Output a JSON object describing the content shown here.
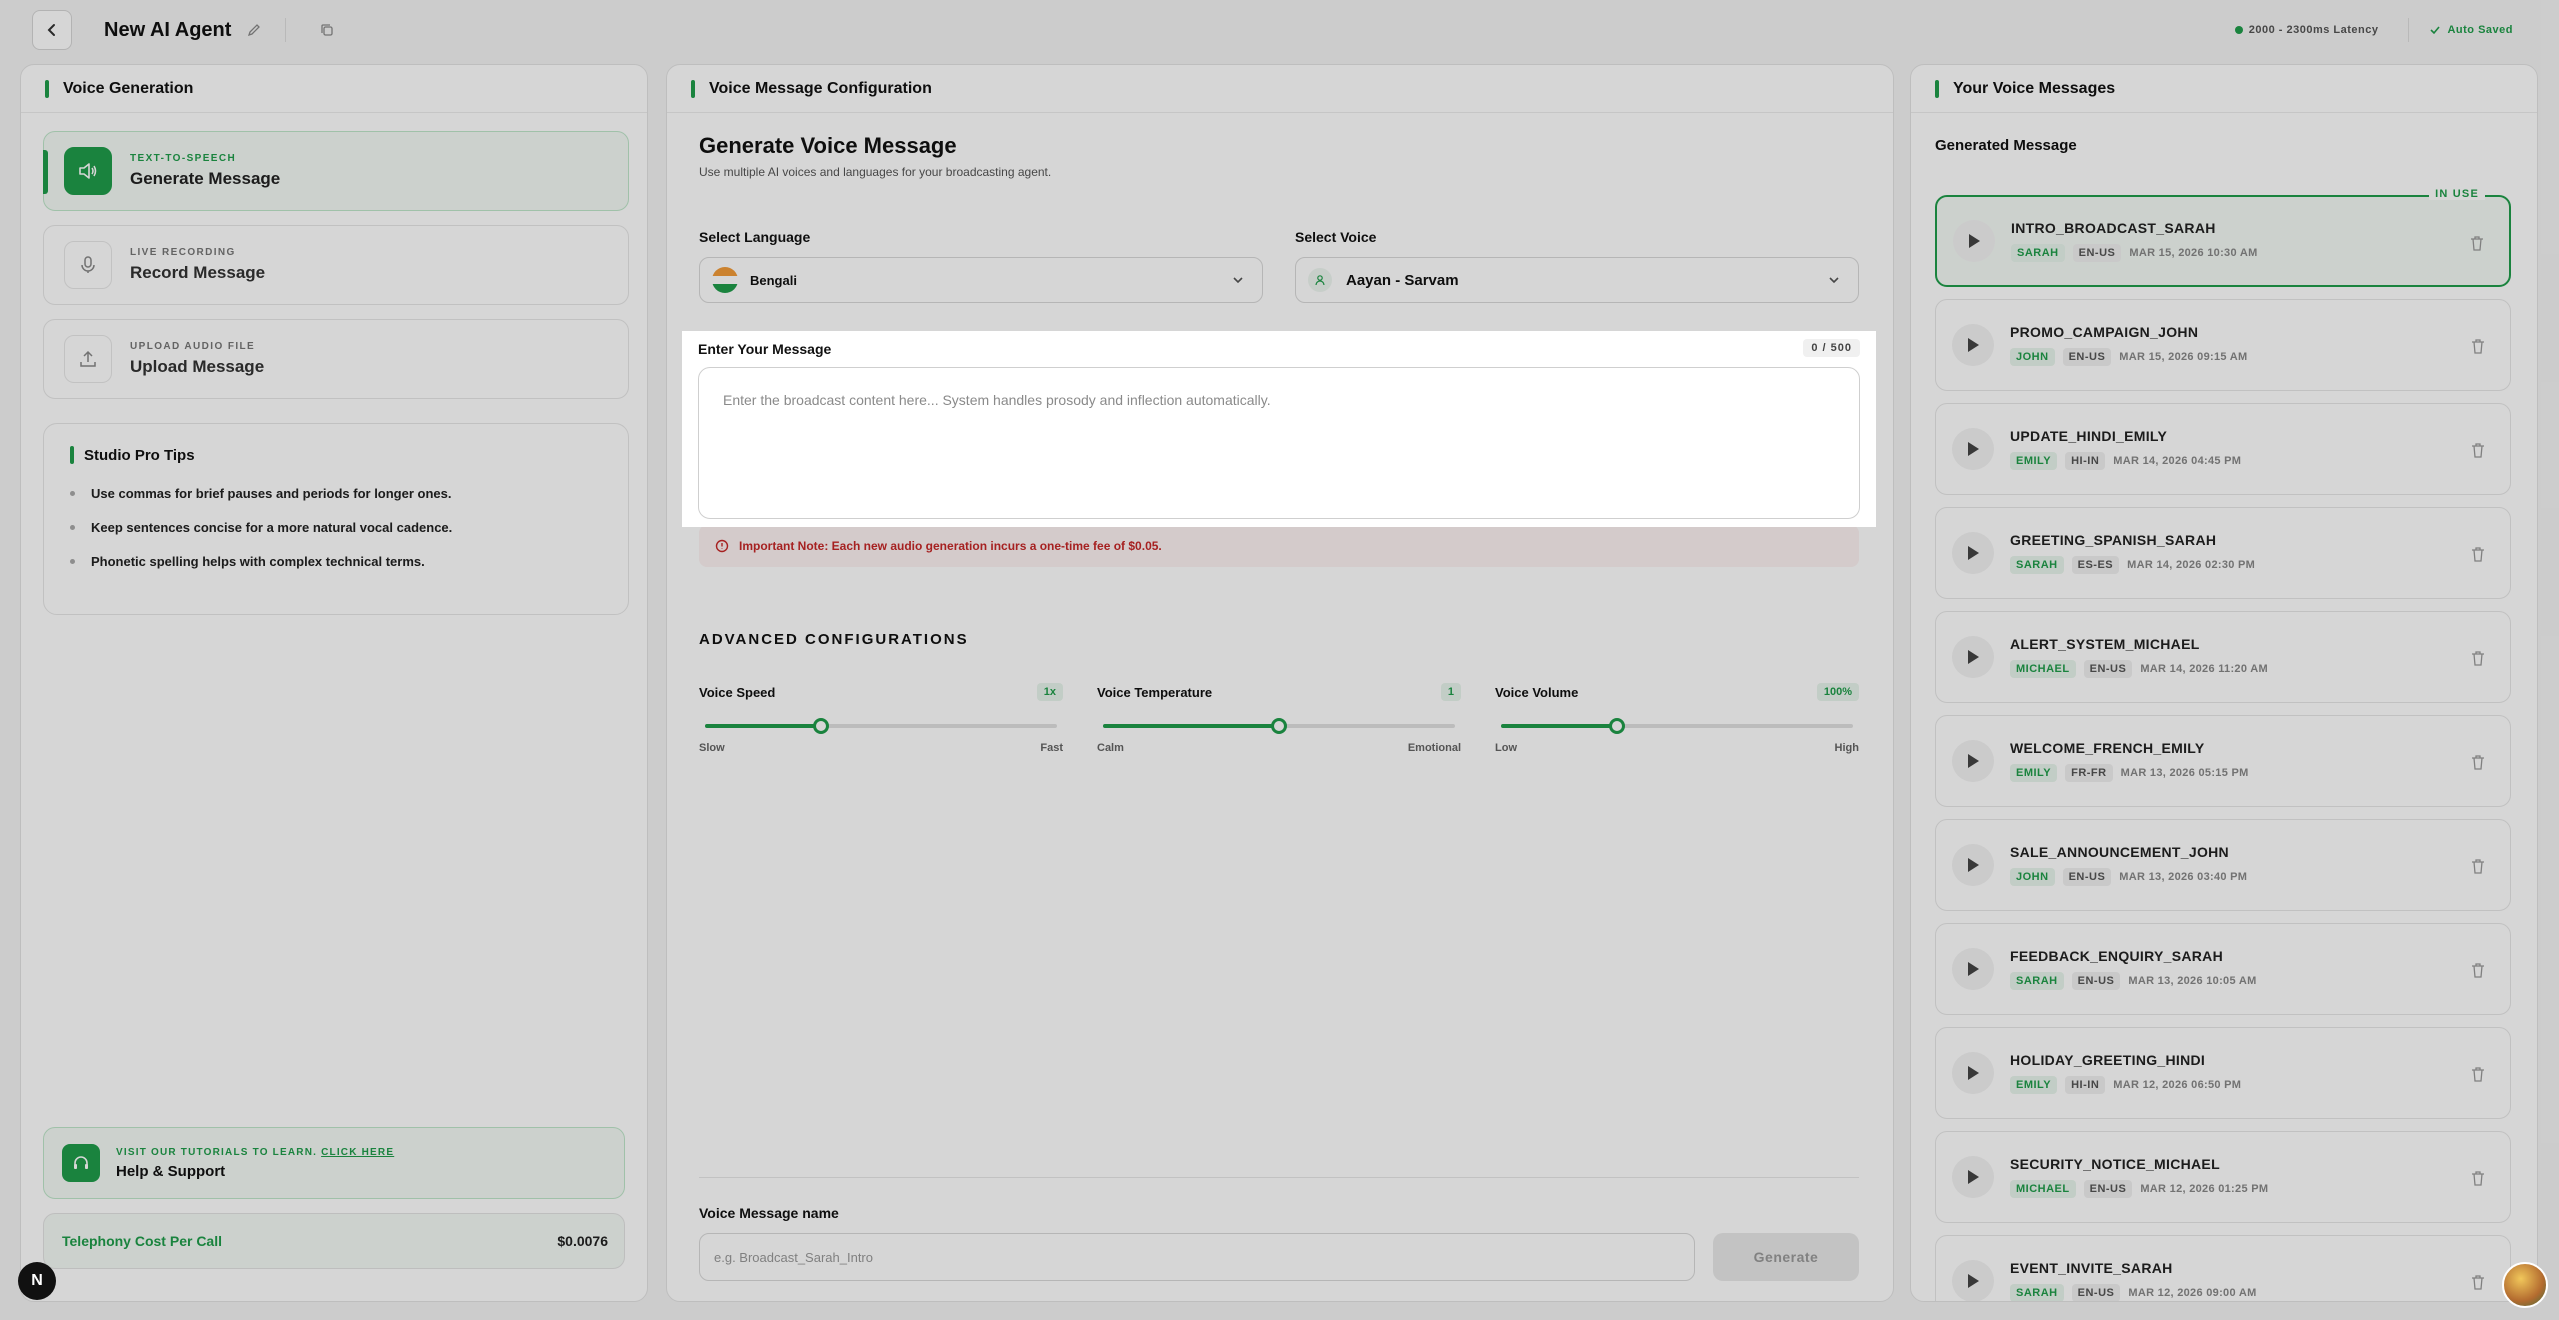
{
  "topbar": {
    "title": "New AI Agent",
    "latency": "2000 - 2300ms Latency",
    "saved": "Auto Saved"
  },
  "left": {
    "header": "Voice Generation",
    "modes": [
      {
        "sub": "TEXT-TO-SPEECH",
        "title": "Generate Message",
        "icon": "speaker-icon"
      },
      {
        "sub": "LIVE RECORDING",
        "title": "Record Message",
        "icon": "microphone-icon"
      },
      {
        "sub": "UPLOAD AUDIO FILE",
        "title": "Upload Message",
        "icon": "upload-icon"
      }
    ],
    "tips": {
      "title": "Studio Pro Tips",
      "items": [
        "Use commas for brief pauses and periods for longer ones.",
        "Keep sentences concise for a more natural vocal cadence.",
        "Phonetic spelling helps with complex technical terms."
      ]
    },
    "help": {
      "sub_prefix": "VISIT OUR TUTORIALS TO LEARN.",
      "sub_link": "CLICK HERE",
      "title": "Help & Support"
    },
    "cost": {
      "label": "Telephony Cost Per Call",
      "value": "$0.0076"
    }
  },
  "center": {
    "header": "Voice Message Configuration",
    "title": "Generate Voice Message",
    "subtitle": "Use multiple AI voices and languages for your broadcasting agent.",
    "language_label": "Select Language",
    "language_value": "Bengali",
    "voice_label": "Select Voice",
    "voice_value": "Aayan - Sarvam",
    "message_label": "Enter Your Message",
    "counter": "0 / 500",
    "message_placeholder": "Enter the broadcast content here... System handles prosody and inflection automatically.",
    "note": "Important Note: Each new audio generation incurs a one-time fee of $0.05.",
    "advanced_title": "ADVANCED CONFIGURATIONS",
    "sliders": [
      {
        "label": "Voice Speed",
        "value": "1x",
        "min_label": "Slow",
        "max_label": "Fast",
        "level": 0.33
      },
      {
        "label": "Voice Temperature",
        "value": "1",
        "min_label": "Calm",
        "max_label": "Emotional",
        "level": 0.5
      },
      {
        "label": "Voice Volume",
        "value": "100%",
        "min_label": "Low",
        "max_label": "High",
        "level": 0.33
      }
    ],
    "name_label": "Voice Message name",
    "name_placeholder": "e.g. Broadcast_Sarah_Intro",
    "generate_label": "Generate"
  },
  "right": {
    "header": "Your Voice Messages",
    "section_title": "Generated Message",
    "in_use_label": "IN USE",
    "messages": [
      {
        "name": "INTRO_BROADCAST_SARAH",
        "voice": "SARAH",
        "lang": "EN-US",
        "date": "MAR 15, 2026 10:30 AM",
        "in_use": true
      },
      {
        "name": "PROMO_CAMPAIGN_JOHN",
        "voice": "JOHN",
        "lang": "EN-US",
        "date": "MAR 15, 2026 09:15 AM"
      },
      {
        "name": "UPDATE_HINDI_EMILY",
        "voice": "EMILY",
        "lang": "HI-IN",
        "date": "MAR 14, 2026 04:45 PM"
      },
      {
        "name": "GREETING_SPANISH_SARAH",
        "voice": "SARAH",
        "lang": "ES-ES",
        "date": "MAR 14, 2026 02:30 PM"
      },
      {
        "name": "ALERT_SYSTEM_MICHAEL",
        "voice": "MICHAEL",
        "lang": "EN-US",
        "date": "MAR 14, 2026 11:20 AM"
      },
      {
        "name": "WELCOME_FRENCH_EMILY",
        "voice": "EMILY",
        "lang": "FR-FR",
        "date": "MAR 13, 2026 05:15 PM"
      },
      {
        "name": "SALE_ANNOUNCEMENT_JOHN",
        "voice": "JOHN",
        "lang": "EN-US",
        "date": "MAR 13, 2026 03:40 PM"
      },
      {
        "name": "FEEDBACK_ENQUIRY_SARAH",
        "voice": "SARAH",
        "lang": "EN-US",
        "date": "MAR 13, 2026 10:05 AM"
      },
      {
        "name": "HOLIDAY_GREETING_HINDI",
        "voice": "EMILY",
        "lang": "HI-IN",
        "date": "MAR 12, 2026 06:50 PM"
      },
      {
        "name": "SECURITY_NOTICE_MICHAEL",
        "voice": "MICHAEL",
        "lang": "EN-US",
        "date": "MAR 12, 2026 01:25 PM"
      },
      {
        "name": "EVENT_INVITE_SARAH",
        "voice": "SARAH",
        "lang": "EN-US",
        "date": "MAR 12, 2026 09:00 AM"
      }
    ]
  },
  "colors": {
    "accent": "#1f9d4a",
    "warning": "#c62828"
  },
  "corner": {
    "logo": "N"
  }
}
